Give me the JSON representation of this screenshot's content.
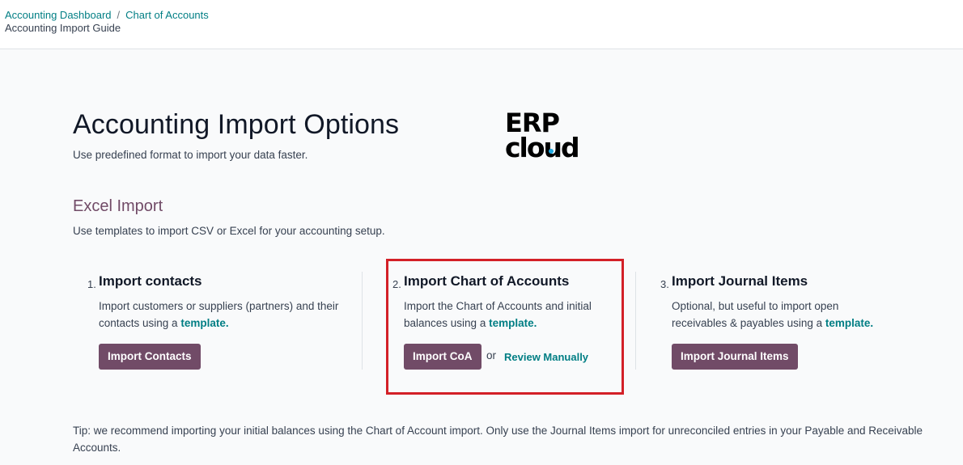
{
  "breadcrumb": {
    "items": [
      "Accounting Dashboard",
      "Chart of Accounts"
    ],
    "separator": "/",
    "current": "Accounting Import Guide"
  },
  "header": {
    "title": "Accounting Import Options",
    "description": "Use predefined format to import your data faster."
  },
  "logo": {
    "line1": "ERP",
    "line2": "cloud"
  },
  "excel_import": {
    "title": "Excel Import",
    "description": "Use templates to import CSV or Excel for your accounting setup."
  },
  "steps": [
    {
      "number": "1.",
      "title": "Import contacts",
      "text": "Import customers or suppliers (partners) and their contacts using a",
      "link": "template.",
      "button": "Import Contacts"
    },
    {
      "number": "2.",
      "title": "Import Chart of Accounts",
      "text": "Import the Chart of Accounts and initial balances using a",
      "link": "template.",
      "button": "Import CoA",
      "or": "or",
      "secondary_link": "Review Manually"
    },
    {
      "number": "3.",
      "title": "Import Journal Items",
      "text": "Optional, but useful to import open receivables & payables using a",
      "link": "template.",
      "button": "Import Journal Items"
    }
  ],
  "tip": "Tip: we recommend importing your initial balances using the Chart of Account import. Only use the Journal Items import for unreconciled entries in your Payable and Receivable Accounts.",
  "colors": {
    "primary": "#714b67",
    "link": "#017e84",
    "highlight": "#d32027",
    "logo_accent": "#1fa9e1"
  },
  "icons": {
    "logo": "erp-cloud-logo"
  }
}
